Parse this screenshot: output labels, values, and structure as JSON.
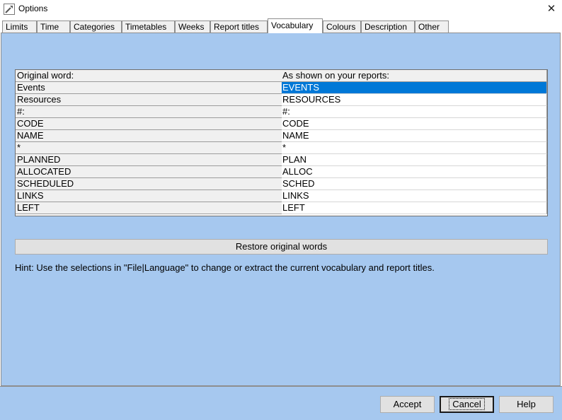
{
  "window": {
    "title": "Options",
    "close_glyph": "✕"
  },
  "tabs": [
    {
      "label": "Limits"
    },
    {
      "label": "Time"
    },
    {
      "label": "Categories"
    },
    {
      "label": "Timetables"
    },
    {
      "label": "Weeks"
    },
    {
      "label": "Report titles"
    },
    {
      "label": "Vocabulary",
      "active": true
    },
    {
      "label": "Colours"
    },
    {
      "label": "Description"
    },
    {
      "label": "Other"
    }
  ],
  "vocabulary": {
    "headers": {
      "original": "Original word:",
      "shown": "As shown on your reports:"
    },
    "rows": [
      {
        "original": "Events",
        "shown": "EVENTS",
        "selected": true
      },
      {
        "original": "Resources",
        "shown": "RESOURCES"
      },
      {
        "original": "#:",
        "shown": "#:"
      },
      {
        "original": "CODE",
        "shown": "CODE"
      },
      {
        "original": "NAME",
        "shown": "NAME"
      },
      {
        "original": "*",
        "shown": "*"
      },
      {
        "original": "PLANNED",
        "shown": "PLAN"
      },
      {
        "original": "ALLOCATED",
        "shown": "ALLOC"
      },
      {
        "original": "SCHEDULED",
        "shown": "SCHED"
      },
      {
        "original": "LINKS",
        "shown": "LINKS"
      },
      {
        "original": "LEFT",
        "shown": "LEFT"
      }
    ]
  },
  "restore_label": "Restore original words",
  "hint": "Hint: Use the selections in \"File|Language\" to change or extract the current vocabulary and report titles.",
  "buttons": {
    "accept": "Accept",
    "cancel": "Cancel",
    "help": "Help"
  },
  "colors": {
    "panel": "#a6c8ef",
    "selection": "#0078d7"
  }
}
